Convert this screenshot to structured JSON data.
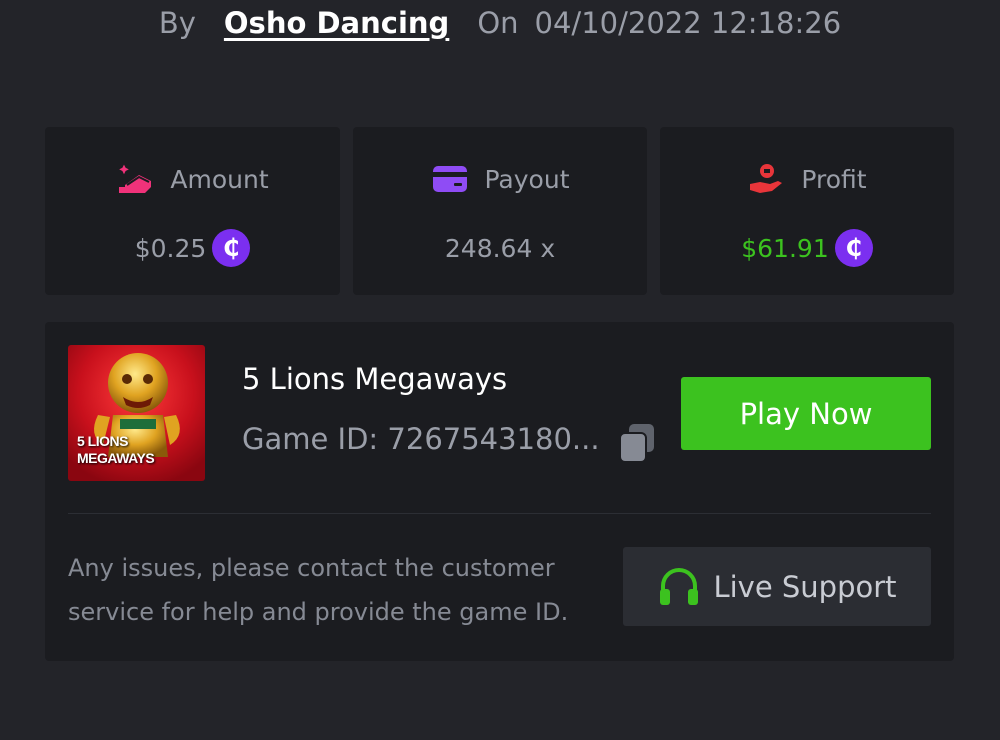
{
  "bet": {
    "by_label": "By",
    "author": "Osho Dancing",
    "on_label": "On",
    "datetime": "04/10/2022 12:18:26"
  },
  "stats": {
    "amount": {
      "label": "Amount",
      "value": "$0.25",
      "icon": "coins-stack-icon",
      "icon_color": "#f0327a"
    },
    "payout": {
      "label": "Payout",
      "value": "248.64 x",
      "icon": "credit-card-icon",
      "icon_color": "#8f4cf5"
    },
    "profit": {
      "label": "Profit",
      "value": "$61.91",
      "icon": "hand-money-icon",
      "icon_color": "#e8353a",
      "value_color": "#3cc21f"
    }
  },
  "currency": {
    "symbol": "₵",
    "color": "#7b2ff0"
  },
  "game": {
    "title": "5 Lions Megaways",
    "id_text": "Game ID: 7267543180...",
    "thumbnail_lines": [
      "5 LIONS",
      "MEGAWAYS"
    ],
    "play_label": "Play Now",
    "play_color": "#3cc21f"
  },
  "support": {
    "help_text": "Any issues, please contact the customer service for help and provide the game ID.",
    "button_label": "Live Support",
    "icon_color": "#3cc21f"
  },
  "colors": {
    "background": "#232429",
    "panel": "#1b1c20",
    "muted_text": "#9a9ea8"
  }
}
